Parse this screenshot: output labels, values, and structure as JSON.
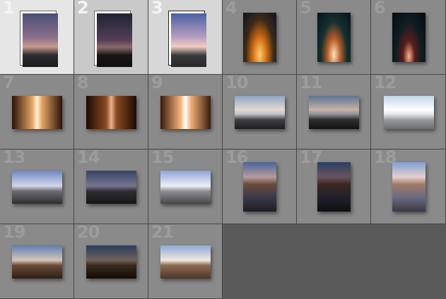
{
  "grid": {
    "columns": 6,
    "cells": [
      {
        "number": "1",
        "state": "sel1",
        "orientation": "portrait",
        "framed": true,
        "tone": "dusk",
        "image": "dusk-tree-photo"
      },
      {
        "number": "2",
        "state": "sel2",
        "orientation": "portrait",
        "framed": true,
        "tone": "duskdark",
        "image": "dusk-tree-photo"
      },
      {
        "number": "3",
        "state": "sel3",
        "orientation": "portrait",
        "framed": true,
        "tone": "dusklight",
        "image": "dusk-tree-photo"
      },
      {
        "number": "4",
        "state": "normal",
        "orientation": "portrait",
        "framed": false,
        "tone": "bridge",
        "image": "bridge-night-photo"
      },
      {
        "number": "5",
        "state": "normal",
        "orientation": "portrait",
        "framed": false,
        "tone": "bridge2",
        "image": "bridge-night-photo"
      },
      {
        "number": "6",
        "state": "normal",
        "orientation": "portrait",
        "framed": false,
        "tone": "bridge3",
        "image": "bridge-night-photo"
      },
      {
        "number": "7",
        "state": "normal",
        "orientation": "landscape",
        "framed": false,
        "tone": "street",
        "image": "street-traffic-photo"
      },
      {
        "number": "8",
        "state": "normal",
        "orientation": "landscape",
        "framed": false,
        "tone": "streetdark",
        "image": "street-traffic-photo"
      },
      {
        "number": "9",
        "state": "normal",
        "orientation": "landscape",
        "framed": false,
        "tone": "streetlight",
        "image": "street-traffic-photo"
      },
      {
        "number": "10",
        "state": "normal",
        "orientation": "landscape",
        "framed": false,
        "tone": "lake",
        "image": "lake-dawn-photo"
      },
      {
        "number": "11",
        "state": "normal",
        "orientation": "landscape",
        "framed": false,
        "tone": "lakedark",
        "image": "lake-dawn-photo"
      },
      {
        "number": "12",
        "state": "normal",
        "orientation": "landscape",
        "framed": false,
        "tone": "lakelight",
        "image": "lake-dawn-photo"
      },
      {
        "number": "13",
        "state": "normal",
        "orientation": "landscape",
        "framed": false,
        "tone": "shore",
        "image": "shore-rocks-photo"
      },
      {
        "number": "14",
        "state": "normal",
        "orientation": "landscape",
        "framed": false,
        "tone": "shoredark",
        "image": "shore-rocks-photo"
      },
      {
        "number": "15",
        "state": "normal",
        "orientation": "landscape",
        "framed": false,
        "tone": "shorelight",
        "image": "shore-rocks-photo"
      },
      {
        "number": "16",
        "state": "normal",
        "orientation": "portrait",
        "framed": false,
        "tone": "rock",
        "image": "rocky-beach-photo"
      },
      {
        "number": "17",
        "state": "normal",
        "orientation": "portrait",
        "framed": false,
        "tone": "rockdark",
        "image": "rocky-beach-photo"
      },
      {
        "number": "18",
        "state": "normal",
        "orientation": "portrait",
        "framed": false,
        "tone": "rocklight",
        "image": "rocky-beach-photo"
      },
      {
        "number": "19",
        "state": "normal",
        "orientation": "landscape",
        "framed": false,
        "tone": "tree",
        "image": "driftwood-tree-photo"
      },
      {
        "number": "20",
        "state": "normal",
        "orientation": "landscape",
        "framed": false,
        "tone": "treedark",
        "image": "driftwood-tree-photo"
      },
      {
        "number": "21",
        "state": "normal",
        "orientation": "landscape",
        "framed": false,
        "tone": "treelight",
        "image": "driftwood-tree-photo"
      }
    ]
  }
}
